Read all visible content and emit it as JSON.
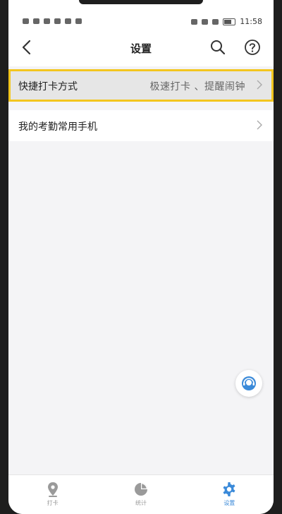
{
  "status_bar": {
    "time": "11:58",
    "left_icons": [
      "signal-icon",
      "wifi-icon",
      "sim-icon",
      "message-icon",
      "chat-icon",
      "notification-icon"
    ],
    "right_icons": [
      "alarm-icon",
      "bluetooth-icon",
      "mute-icon",
      "battery-icon"
    ]
  },
  "header": {
    "title": "设置",
    "back_icon": "back-arrow-icon",
    "search_icon": "search-icon",
    "help_icon": "help-icon"
  },
  "settings": {
    "items": [
      {
        "label": "快捷打卡方式",
        "value": "极速打卡 、提醒闹钟",
        "highlighted": true
      },
      {
        "label": "我的考勤常用手机",
        "value": ""
      }
    ]
  },
  "floating_button": {
    "icon": "customer-service-icon"
  },
  "tabbar": {
    "tabs": [
      {
        "label": "打卡",
        "icon": "location-pin-icon",
        "active": false
      },
      {
        "label": "统计",
        "icon": "pie-chart-icon",
        "active": false
      },
      {
        "label": "设置",
        "icon": "gear-icon",
        "active": true
      }
    ]
  },
  "colors": {
    "highlight_border": "#f3c61f",
    "accent": "#3b8ad9",
    "background": "#f4f4f6"
  }
}
